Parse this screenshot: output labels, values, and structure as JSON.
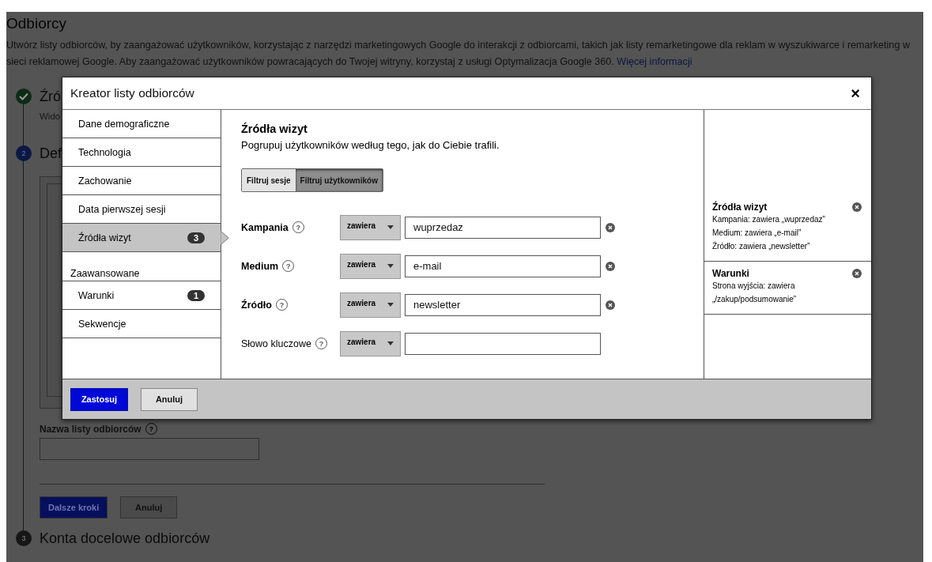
{
  "page": {
    "title": "Odbiorcy",
    "description": "Utwórz listy odbiorców, by zaangażować użytkowników, korzystając z narzędzi marketingowych Google do interakcji z odbiorcami, takich jak listy remarketingowe dla reklam w wyszukiwarce i remarketing w sieci reklamowej Google. Aby zaangażować użytkowników powracających do Twojej witryny, korzystaj z usługi Optymalizacja Google 360.",
    "more_link": "Więcej informacji"
  },
  "steps": [
    {
      "kind": "done",
      "title": "Źró",
      "subtitle": "Wido"
    },
    {
      "kind": "current",
      "number": "2",
      "title": "Def"
    },
    {
      "kind": "pending",
      "number": "3",
      "title": "Konta docelowe odbiorców"
    }
  ],
  "list_name": {
    "label": "Nazwa listy odbiorców",
    "help": "?"
  },
  "page_buttons": [
    {
      "kind": "primary",
      "label": "Dalsze kroki",
      "disabled": true
    },
    {
      "kind": "secondary",
      "label": "Anuluj"
    }
  ],
  "dialog": {
    "title": "Kreator listy odbiorców",
    "close": "×",
    "nav": [
      {
        "kind": "item",
        "label": "Dane demograficzne",
        "selected": false
      },
      {
        "kind": "item",
        "label": "Technologia",
        "selected": false
      },
      {
        "kind": "item",
        "label": "Zachowanie",
        "selected": false
      },
      {
        "kind": "item",
        "label": "Data pierwszej sesji",
        "selected": false
      },
      {
        "kind": "item",
        "label": "Źródła wizyt",
        "badge": "3",
        "selected": true
      },
      {
        "kind": "header",
        "label": "Zaawansowane"
      },
      {
        "kind": "item",
        "label": "Warunki",
        "badge": "1",
        "selected": false
      },
      {
        "kind": "item",
        "label": "Sekwencje",
        "selected": false
      }
    ],
    "heading": "Źródła wizyt",
    "subheading": "Pogrupuj użytkowników według tego, jak do Ciebie trafili.",
    "scope": [
      {
        "label": "Filtruj sesje",
        "selected": false
      },
      {
        "label": "Filtruj użytkowników",
        "selected": true
      }
    ],
    "filters": [
      {
        "label": "Kampania",
        "help": "?",
        "operator": "zawiera",
        "value": "wuprzedaz",
        "removable": true
      },
      {
        "label": "Medium",
        "help": "?",
        "operator": "zawiera",
        "value": "e-mail",
        "removable": true
      },
      {
        "label": "Źródło",
        "help": "?",
        "operator": "zawiera",
        "value": "newsletter",
        "removable": true
      },
      {
        "label": "Słowo kluczowe",
        "help": "?",
        "operator": "zawiera",
        "removable": false
      }
    ],
    "summary": [
      {
        "title": "Źródła wizyt",
        "lines": [
          "Kampania: zawiera „wuprzedaz”",
          "Medium: zawiera „e-mail”",
          "Źródło: zawiera „newsletter”"
        ]
      },
      {
        "title": "Warunki",
        "lines": [
          "Strona wyjścia: zawiera „/zakup/podsumowanie”"
        ]
      }
    ],
    "buttons": [
      {
        "kind": "primary",
        "label": "Zastosuj"
      },
      {
        "kind": "secondary",
        "label": "Anuluj"
      }
    ]
  }
}
